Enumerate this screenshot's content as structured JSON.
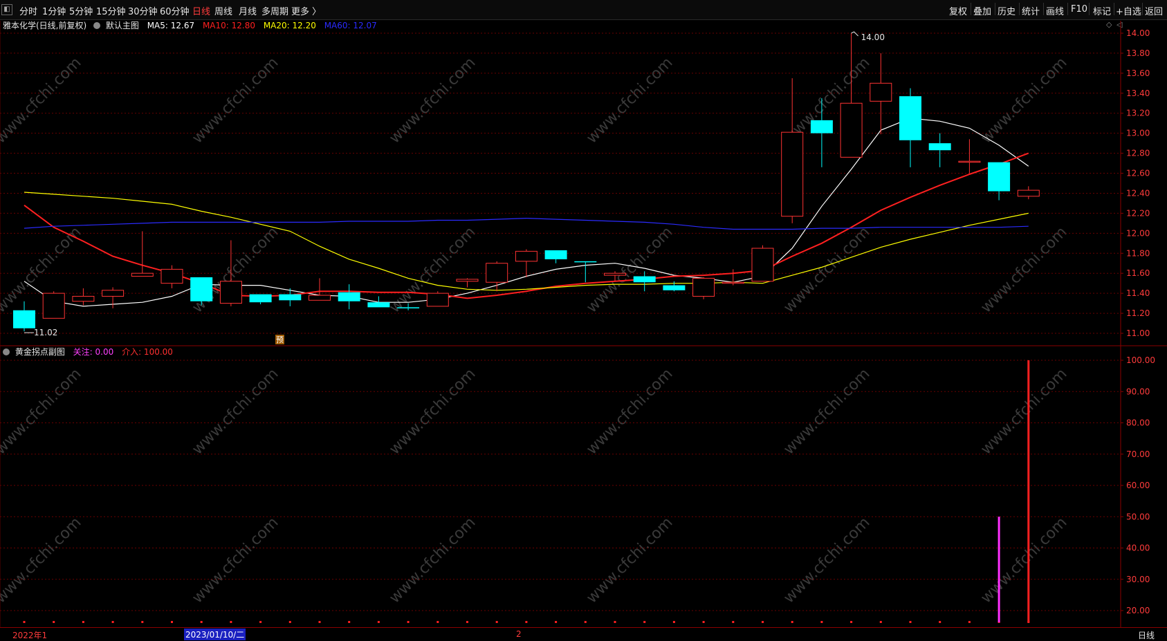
{
  "toolbar": {
    "periods": [
      "分时",
      "1分钟",
      "5分钟",
      "15分钟",
      "30分钟",
      "60分钟",
      "日线",
      "周线",
      "月线",
      "多周期",
      "更多 〉"
    ],
    "active_period": "日线",
    "right_buttons": [
      "复权",
      "叠加",
      "历史",
      "统计",
      "画线",
      "F10",
      "标记",
      "+自选",
      "返回"
    ]
  },
  "main_panel": {
    "title": "雅本化学(日线,前复权)",
    "indicator_name": "默认主图",
    "ma": [
      {
        "label": "MA5: 12.67",
        "color": "#ffffff"
      },
      {
        "label": "MA10: 12.80",
        "color": "#ff2020"
      },
      {
        "label": "MA20: 12.20",
        "color": "#ffff00"
      },
      {
        "label": "MA60: 12.07",
        "color": "#2b2bff"
      }
    ],
    "high_label": "14.00",
    "low_label": "11.02",
    "marker_label": "预"
  },
  "sub_panel": {
    "title": "黄金拐点副图",
    "legend": [
      {
        "label": "关注: 0.00",
        "color": "#ff40ff"
      },
      {
        "label": "介入: 100.00",
        "color": "#ff3030"
      }
    ]
  },
  "watermark": "www.cfchi.com",
  "bottom_axis": {
    "labels": [
      "2022年1",
      "2023/01/10/二",
      "2"
    ],
    "period_label": "日线"
  },
  "colors": {
    "up": "#ff3333",
    "down": "#00ffff",
    "grid": "#6b0000",
    "background": "#000000"
  },
  "chart_data": {
    "type": "candlestick",
    "price_axis": {
      "ylim": [
        10.9,
        14.1
      ],
      "ticks": [
        "14.00",
        "13.80",
        "13.60",
        "13.40",
        "13.20",
        "13.00",
        "12.80",
        "12.60",
        "12.40",
        "12.20",
        "12.00",
        "11.80",
        "11.60",
        "11.40",
        "11.20",
        "11.00"
      ]
    },
    "candles": [
      {
        "o": 11.23,
        "h": 11.32,
        "l": 11.02,
        "c": 11.05
      },
      {
        "o": 11.15,
        "h": 11.42,
        "l": 11.15,
        "c": 11.4
      },
      {
        "o": 11.32,
        "h": 11.45,
        "l": 11.28,
        "c": 11.37
      },
      {
        "o": 11.37,
        "h": 11.46,
        "l": 11.25,
        "c": 11.43
      },
      {
        "o": 11.57,
        "h": 12.02,
        "l": 11.57,
        "c": 11.6
      },
      {
        "o": 11.5,
        "h": 11.68,
        "l": 11.45,
        "c": 11.64
      },
      {
        "o": 11.56,
        "h": 11.56,
        "l": 11.28,
        "c": 11.32
      },
      {
        "o": 11.3,
        "h": 11.93,
        "l": 11.27,
        "c": 11.52
      },
      {
        "o": 11.39,
        "h": 11.39,
        "l": 11.29,
        "c": 11.31
      },
      {
        "o": 11.39,
        "h": 11.45,
        "l": 11.27,
        "c": 11.33
      },
      {
        "o": 11.33,
        "h": 11.55,
        "l": 11.33,
        "c": 11.38
      },
      {
        "o": 11.41,
        "h": 11.49,
        "l": 11.24,
        "c": 11.32
      },
      {
        "o": 11.31,
        "h": 11.37,
        "l": 11.26,
        "c": 11.26
      },
      {
        "o": 11.26,
        "h": 11.3,
        "l": 11.23,
        "c": 11.25
      },
      {
        "o": 11.27,
        "h": 11.42,
        "l": 11.27,
        "c": 11.4
      },
      {
        "o": 11.52,
        "h": 11.55,
        "l": 11.46,
        "c": 11.54
      },
      {
        "o": 11.51,
        "h": 11.72,
        "l": 11.42,
        "c": 11.7
      },
      {
        "o": 11.72,
        "h": 11.84,
        "l": 11.56,
        "c": 11.82
      },
      {
        "o": 11.83,
        "h": 11.83,
        "l": 11.7,
        "c": 11.74
      },
      {
        "o": 11.72,
        "h": 11.72,
        "l": 11.51,
        "c": 11.71
      },
      {
        "o": 11.58,
        "h": 11.62,
        "l": 11.52,
        "c": 11.6
      },
      {
        "o": 11.57,
        "h": 11.62,
        "l": 11.42,
        "c": 11.51
      },
      {
        "o": 11.48,
        "h": 11.52,
        "l": 11.42,
        "c": 11.43
      },
      {
        "o": 11.37,
        "h": 11.56,
        "l": 11.34,
        "c": 11.55
      },
      {
        "o": 11.5,
        "h": 11.64,
        "l": 11.48,
        "c": 11.51
      },
      {
        "o": 11.52,
        "h": 11.88,
        "l": 11.52,
        "c": 11.85
      },
      {
        "o": 12.17,
        "h": 13.55,
        "l": 12.1,
        "c": 13.01
      },
      {
        "o": 13.13,
        "h": 13.35,
        "l": 12.66,
        "c": 13.0
      },
      {
        "o": 12.76,
        "h": 14.0,
        "l": 12.76,
        "c": 13.3
      },
      {
        "o": 13.32,
        "h": 13.8,
        "l": 12.99,
        "c": 13.5
      },
      {
        "o": 13.37,
        "h": 13.45,
        "l": 12.66,
        "c": 12.93
      },
      {
        "o": 12.9,
        "h": 13.0,
        "l": 12.66,
        "c": 12.83
      },
      {
        "o": 12.72,
        "h": 12.94,
        "l": 12.6,
        "c": 12.72
      },
      {
        "o": 12.71,
        "h": 12.71,
        "l": 12.33,
        "c": 12.42
      },
      {
        "o": 12.37,
        "h": 12.47,
        "l": 12.34,
        "c": 12.43
      }
    ],
    "series": [
      {
        "name": "MA5",
        "color": "#ffffff",
        "values": [
          11.52,
          11.32,
          11.27,
          11.29,
          11.31,
          11.37,
          11.49,
          11.48,
          11.48,
          11.43,
          11.38,
          11.37,
          11.31,
          11.31,
          11.34,
          11.4,
          11.48,
          11.57,
          11.64,
          11.68,
          11.7,
          11.65,
          11.58,
          11.55,
          11.51,
          11.57,
          11.85,
          12.27,
          12.64,
          13.03,
          13.15,
          13.12,
          13.05,
          12.88,
          12.67
        ]
      },
      {
        "name": "MA10",
        "color": "#ff2020",
        "values": [
          12.28,
          12.06,
          11.92,
          11.77,
          11.68,
          11.6,
          11.5,
          11.38,
          11.37,
          11.38,
          11.42,
          11.42,
          11.41,
          11.41,
          11.39,
          11.35,
          11.38,
          11.42,
          11.47,
          11.5,
          11.52,
          11.54,
          11.57,
          11.58,
          11.6,
          11.63,
          11.77,
          11.9,
          12.06,
          12.23,
          12.36,
          12.48,
          12.59,
          12.69,
          12.8
        ]
      },
      {
        "name": "MA20",
        "color": "#ffff00",
        "values": [
          12.41,
          12.39,
          12.37,
          12.35,
          12.32,
          12.29,
          12.22,
          12.16,
          12.09,
          12.02,
          11.87,
          11.74,
          11.65,
          11.55,
          11.48,
          11.44,
          11.43,
          11.44,
          11.46,
          11.48,
          11.49,
          11.49,
          11.5,
          11.5,
          11.51,
          11.5,
          11.58,
          11.66,
          11.76,
          11.86,
          11.94,
          12.01,
          12.08,
          12.14,
          12.2
        ]
      },
      {
        "name": "MA60",
        "color": "#2b2bff",
        "values": [
          12.05,
          12.07,
          12.08,
          12.09,
          12.1,
          12.11,
          12.11,
          12.11,
          12.11,
          12.11,
          12.11,
          12.12,
          12.12,
          12.12,
          12.13,
          12.13,
          12.14,
          12.15,
          12.14,
          12.13,
          12.12,
          12.11,
          12.09,
          12.06,
          12.04,
          12.04,
          12.04,
          12.05,
          12.05,
          12.06,
          12.06,
          12.06,
          12.06,
          12.06,
          12.07
        ]
      }
    ],
    "indicator": {
      "ylim": [
        0,
        105
      ],
      "ticks": [
        "100.00",
        "90.00",
        "80.00",
        "70.00",
        "60.00",
        "50.00",
        "40.00",
        "30.00",
        "20.00"
      ],
      "bars": [
        {
          "index": 33,
          "value": 50,
          "color": "#ff30ff"
        },
        {
          "index": 34,
          "value": 100,
          "color": "#ff2020"
        }
      ]
    }
  }
}
